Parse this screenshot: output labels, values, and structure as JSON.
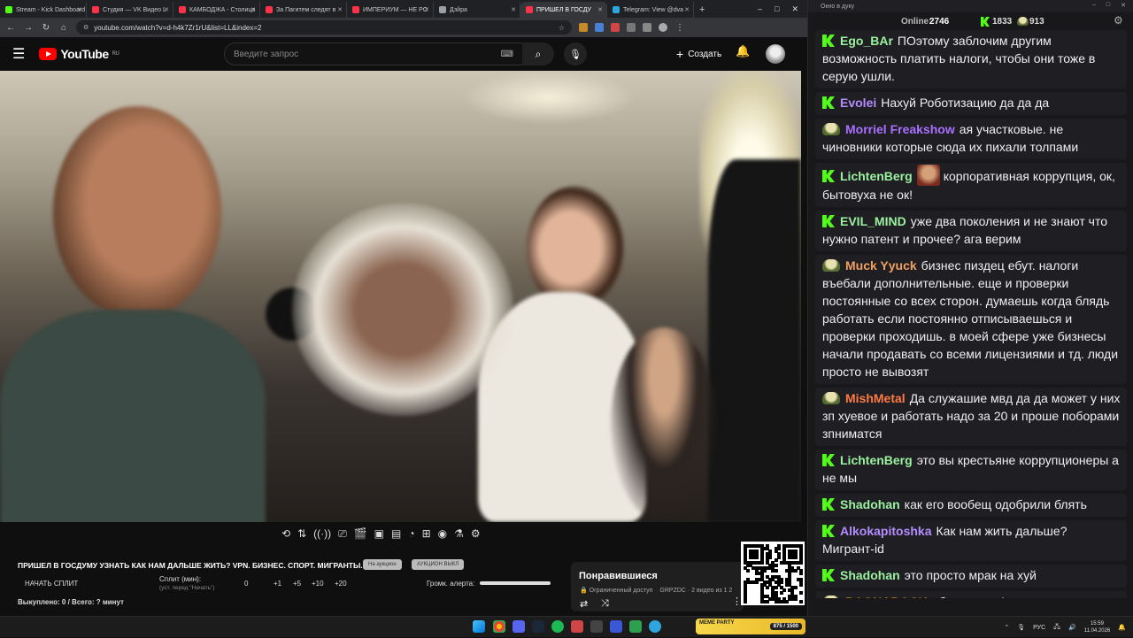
{
  "browser": {
    "tabs": [
      {
        "title": "Stream - Kick Dashboard",
        "color": "#53fc18"
      },
      {
        "title": "Студия — VK Видео L",
        "color": "#ff3347"
      },
      {
        "title": "КАМБОДЖА - Столица",
        "color": "#ff3347"
      },
      {
        "title": "За Пагитем следят в ",
        "color": "#ff3347"
      },
      {
        "title": "ИМПЕРИУМ — НЕ РС",
        "color": "#ff3347"
      },
      {
        "title": "Дзйра",
        "color": "#9aa0a6"
      },
      {
        "title": "ПРИШЕЛ В ГОСДУ",
        "color": "#ff3347",
        "active": true
      },
      {
        "title": "Telegram: View @dva",
        "color": "#2ea6dd"
      }
    ],
    "url": "youtube.com/watch?v=d-h4k7Zr1rU&list=LL&index=2",
    "new_tab": "+"
  },
  "youtube": {
    "logo_text": "YouTube",
    "logo_region": "RU",
    "search_placeholder": "Введите запрос",
    "create_label": "Создать"
  },
  "player": {
    "title": "ПРИШЕЛ В ГОСДУМУ УЗНАТЬ КАК НАМ ДАЛЬШЕ ЖИТЬ? VPN. БИЗНЕС. СПОРТ. МИГРАНТЫ.",
    "pill_1": "На аукцион",
    "pill_2": "АУКЦИОН ВЫКЛ",
    "start_split": "НАЧАТЬ СПЛИТ",
    "split_label": "Сплит (мин):",
    "split_hint": "(уст. перед \"Начать\")",
    "split_value": "0",
    "inc_1": "+1",
    "inc_5": "+5",
    "inc_10": "+10",
    "inc_20": "+20",
    "alert_volume": "Громк. алерта:",
    "bought": "Выкуплено: 0 / Всего: ? минут"
  },
  "liked": {
    "heading": "Понравившиеся",
    "access": "Ограниченный доступ",
    "owner": "GRPZDC · 2 видео из 1 2"
  },
  "chat": {
    "window_title": "Окно в дуку",
    "online_label": "Online:",
    "online_value": "2746",
    "kick_count": "1833",
    "other_count": "913",
    "messages": [
      {
        "badge": "K",
        "nick": "Ego_BAr",
        "color": "#9bf0a0",
        "text": "ПОэтому заблочим другим возможность платить налоги, чтобы они тоже в серую ушли."
      },
      {
        "badge": "K",
        "nick": "Evolei",
        "color": "#b58cff",
        "text": "Нахуй Роботизацию да да да"
      },
      {
        "badge": "P",
        "nick": "Morriel Freakshow",
        "color": "#a970ff",
        "text": "ая участковые. не чиновники которые сюда их пихали толпами"
      },
      {
        "badge": "K",
        "nick": "LichtenBerg",
        "color": "#9bf0a0",
        "emote": true,
        "text": "корпоративная коррупция, ок, бытовуха не ок!"
      },
      {
        "badge": "K",
        "nick": "EVIL_MIND",
        "color": "#9bf0a0",
        "text": "уже два поколения и не знают что нужно патент и прочее? ага верим"
      },
      {
        "badge": "P",
        "nick": "Muck Yyuck",
        "color": "#f0a060",
        "text": "бизнес пиздец ебут. налоги въебали дополнительные. еще и проверки постоянные со всех сторон. думаешь когда блядь работать если постоянно отписываешься и проверки проходишь. в моей сфере уже бизнесы начали продавать со всеми лицензиями и тд. люди просто не вывозят"
      },
      {
        "badge": "P",
        "nick": "MishMetal",
        "color": "#ff7a45",
        "text": "Да служашие мвд да да может у них зп хуевое и работать надо за 20 и проше поборами зпниматся"
      },
      {
        "badge": "K",
        "nick": "LichtenBerg",
        "color": "#9bf0a0",
        "text": "это вы крестьяне коррупционеры а не мы"
      },
      {
        "badge": "K",
        "nick": "Shadohan",
        "color": "#9bf0a0",
        "text": "как его вообещ одобрили блять"
      },
      {
        "badge": "K",
        "nick": "Alkokapitoshka",
        "color": "#b58cff",
        "text": "Как нам жить дальше? Мигрант-id"
      },
      {
        "badge": "K",
        "nick": "Shadohan",
        "color": "#9bf0a0",
        "text": "это просто мрак на хуй"
      },
      {
        "badge": "P",
        "nick": "RAGNAROCK",
        "color": "#ffb020",
        "text": "ебать ради Амиранчика столько суеты"
      }
    ]
  },
  "taskbar": {
    "lang": "РУС",
    "time": "15:59",
    "date": "11.04.2026",
    "meme_party": "MEME PARTY",
    "meme_counter": "875 / 1500"
  }
}
